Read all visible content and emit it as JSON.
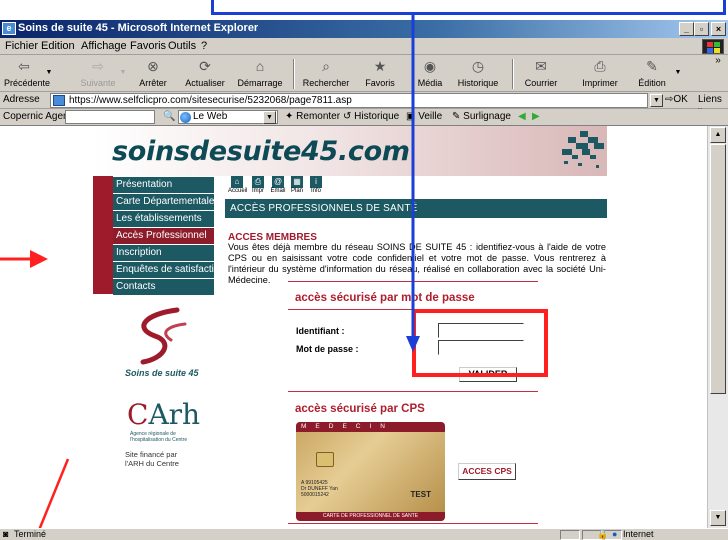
{
  "window": {
    "title": "Soins de suite 45 - Microsoft Internet Explorer",
    "controls": [
      "_",
      "¬",
      "×"
    ]
  },
  "menu": [
    "Fichier",
    "Edition",
    "Affichage",
    "Favoris",
    "Outils",
    "?"
  ],
  "toolbar": {
    "buttons": [
      {
        "label": "Précédente",
        "icon": "back-arrow-icon"
      },
      {
        "label": "Suivante",
        "icon": "forward-arrow-icon"
      },
      {
        "label": "Arrêter",
        "icon": "stop-icon"
      },
      {
        "label": "Actualiser",
        "icon": "refresh-icon"
      },
      {
        "label": "Démarrage",
        "icon": "home-icon"
      },
      {
        "label": "Rechercher",
        "icon": "search-icon"
      },
      {
        "label": "Favoris",
        "icon": "favorites-icon"
      },
      {
        "label": "Média",
        "icon": "media-icon"
      },
      {
        "label": "Historique",
        "icon": "history-icon"
      },
      {
        "label": "Courrier",
        "icon": "mail-icon"
      },
      {
        "label": "Imprimer",
        "icon": "print-icon"
      },
      {
        "label": "Édition",
        "icon": "edit-icon"
      }
    ],
    "overflow": "»"
  },
  "address": {
    "label": "Adresse",
    "url": "https://www.selfclicpro.com/sitesecurise/5232068/page7811.asp",
    "go": "OK",
    "links": "Liens »"
  },
  "copernic": {
    "agent_label": "Copernic Agent",
    "search_value": "",
    "web_option": "Le Web",
    "items": [
      "Remonter",
      "Historique",
      "Veille",
      "Surlignage"
    ]
  },
  "site": {
    "logo": "soinsdesuite45.com",
    "nav": [
      {
        "label": "Présentation",
        "active": false
      },
      {
        "label": "Carte Départementale",
        "active": false
      },
      {
        "label": "Les établissements",
        "active": false
      },
      {
        "label": "Accès Professionnel",
        "active": true
      },
      {
        "label": "Inscription",
        "active": false
      },
      {
        "label": "Enquêtes de satisfaction",
        "active": false
      },
      {
        "label": "Contacts",
        "active": false
      }
    ],
    "top_icons": [
      "Accueil",
      "Impr",
      "Email",
      "Plan",
      "Info"
    ],
    "section_title": "ACCÈS PROFESSIONNELS DE SANTÉ",
    "members_heading": "ACCES MEMBRES",
    "intro": "Vous êtes déjà membre du réseau SOINS DE SUITE 45 : identifiez-vous à l'aide de votre CPS ou en saisissant votre code confidentiel et votre mot de passe. Vous rentrerez à l'intérieur du système d'information du réseau, réalisé en collaboration avec la société Uni-Médecine.",
    "pwd_heading": "accès sécurisé par mot de passe",
    "id_label": "Identifiant :",
    "pw_label": "Mot de passe :",
    "id_value": "",
    "pw_value": "",
    "validate_label": "VALIDER",
    "cps_heading": "accès sécurisé par CPS",
    "cps_button": "ACCES CPS",
    "card": {
      "top": "MEDECIN",
      "bottom": "CARTE DE PROFESSIONNEL DE SANTE",
      "stamp": "TEST",
      "number": "A 99105425\nDr DUNEFF Yan\n5000015242"
    },
    "soins_logo_text": "Soins de suite 45",
    "arh_name": "Arh",
    "arh_sub": "Agence régionale de l'hospitalisation du Centre",
    "arh_note": "Site financé par l'ARH du Centre"
  },
  "status": {
    "text": "Terminé",
    "zone": "Internet"
  },
  "colors": {
    "teal": "#1c5962",
    "crimson": "#9e1b2c",
    "annotation_blue": "#1a3fd6",
    "annotation_red": "#ff2020"
  }
}
